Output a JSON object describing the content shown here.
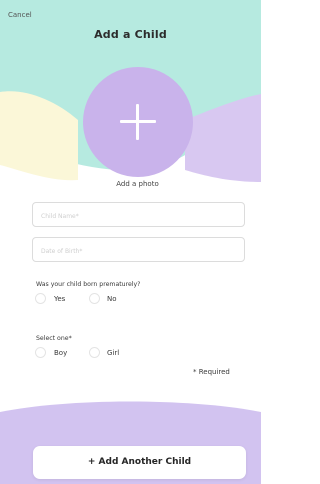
{
  "header": {
    "cancel_label": "Cancel",
    "title": "Add a Child"
  },
  "photo": {
    "icon": "plus-icon",
    "label": "Add a photo"
  },
  "form": {
    "name_placeholder": "Child Name*",
    "dob_placeholder": "Date of Birth*",
    "premature_question": "Was your child born prematurely?",
    "premature_options": [
      "Yes",
      "No"
    ],
    "gender_question": "Select one*",
    "gender_options": [
      "Boy",
      "Girl"
    ],
    "required_note": "* Required"
  },
  "footer": {
    "add_another_label": "+ Add Another Child"
  },
  "colors": {
    "teal": "#b3eadf",
    "lavender": "#c9b3eb",
    "bottom_lavender": "#cfc0ef",
    "cream": "#fbf7dc"
  }
}
